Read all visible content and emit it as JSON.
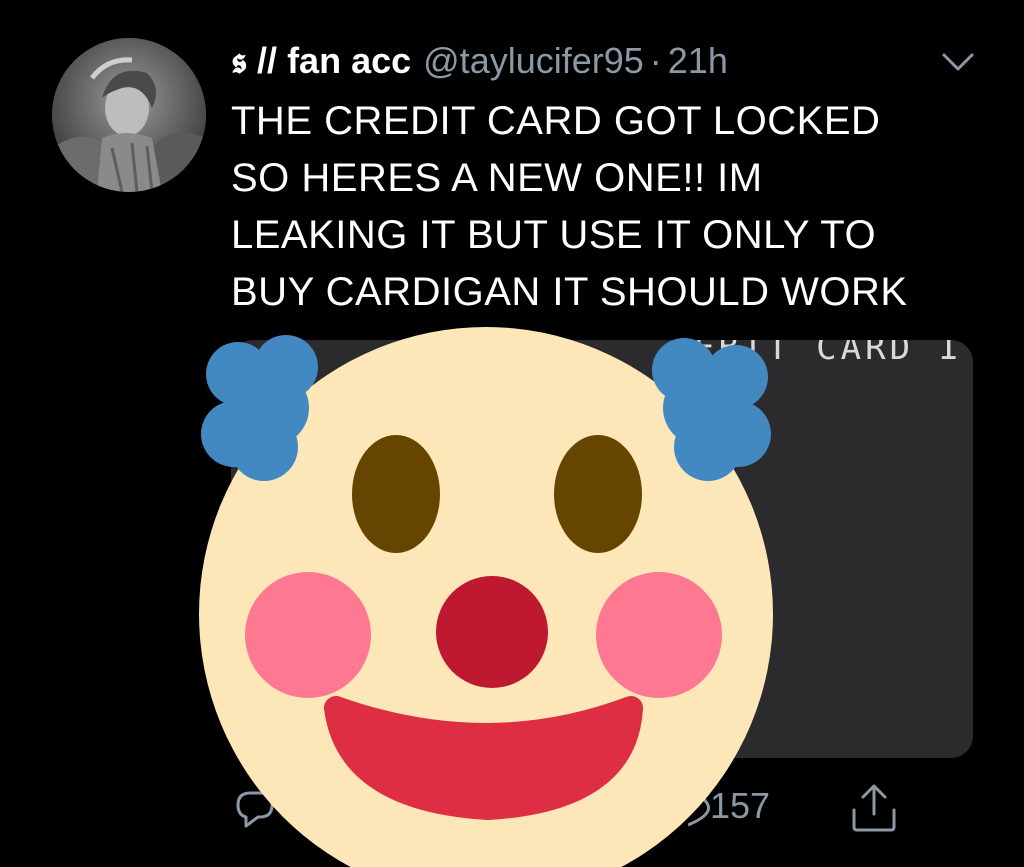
{
  "tweet": {
    "display_name": "𝖘 // fan acc",
    "handle": "@taylucifer95",
    "separator": "·",
    "time": "21h",
    "text_lines": [
      "THE CREDIT CARD GOT LOCKED",
      "SO HERES A NEW ONE!! IM",
      "LEAKING IT BUT USE IT ONLY TO",
      "BUY CARDIGAN IT SHOULD WORK"
    ],
    "media_visible_text": "EBIT CARD I",
    "like_count": "157"
  },
  "icons": {
    "avatar": "profile-photo",
    "caret": "chevron-down-icon",
    "reply": "reply-icon",
    "like": "heart-icon",
    "share": "share-icon",
    "overlay": "clown-face-emoji"
  },
  "colors": {
    "background": "#000000",
    "text": "#ffffff",
    "secondary_text": "#8b98a5",
    "media_background": "#2b2b2d",
    "clown_face": "#fde7b8",
    "clown_hair": "#4289c1",
    "clown_eyes": "#664500",
    "clown_nose": "#be1931",
    "clown_cheeks": "#ff7892",
    "clown_mouth": "#dd2e44"
  }
}
